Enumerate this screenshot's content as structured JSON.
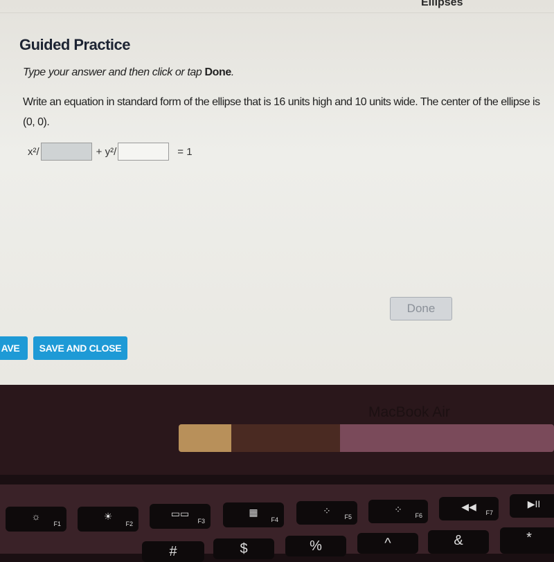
{
  "header": {
    "unit_title": "Ellipses"
  },
  "main": {
    "title": "Guided Practice",
    "instruction_prefix": "Type your answer and then click or tap ",
    "instruction_bold": "Done",
    "instruction_suffix": ".",
    "question": "Write an equation in standard form of the ellipse that is 16 units high and 10 units wide. The center of the ellipse is (0, 0).",
    "equation": {
      "x_term": "x²/",
      "plus_y_term": "+ y²/",
      "equals": "= 1",
      "x_denominator": "",
      "y_denominator": ""
    },
    "done_label": "Done"
  },
  "footer": {
    "save_label": "AVE",
    "save_close_label": "SAVE AND CLOSE"
  },
  "device": {
    "brand": "MacBook Air"
  },
  "keyboard": {
    "fkeys": [
      {
        "icon": "☼",
        "label": "F1"
      },
      {
        "icon": "☀",
        "label": "F2"
      },
      {
        "icon": "▭▭",
        "label": "F3"
      },
      {
        "icon": "▦",
        "label": "F4"
      },
      {
        "icon": "⁘",
        "label": "F5"
      },
      {
        "icon": "⁘",
        "label": "F6"
      },
      {
        "icon": "◀◀",
        "label": "F7"
      },
      {
        "icon": "▶II",
        "label": ""
      }
    ],
    "number_row": [
      "#",
      "$",
      "%",
      "^",
      "&",
      "*"
    ]
  },
  "colors": {
    "accent": "#1e9ad6",
    "done_disabled": "#d3d6d9"
  }
}
